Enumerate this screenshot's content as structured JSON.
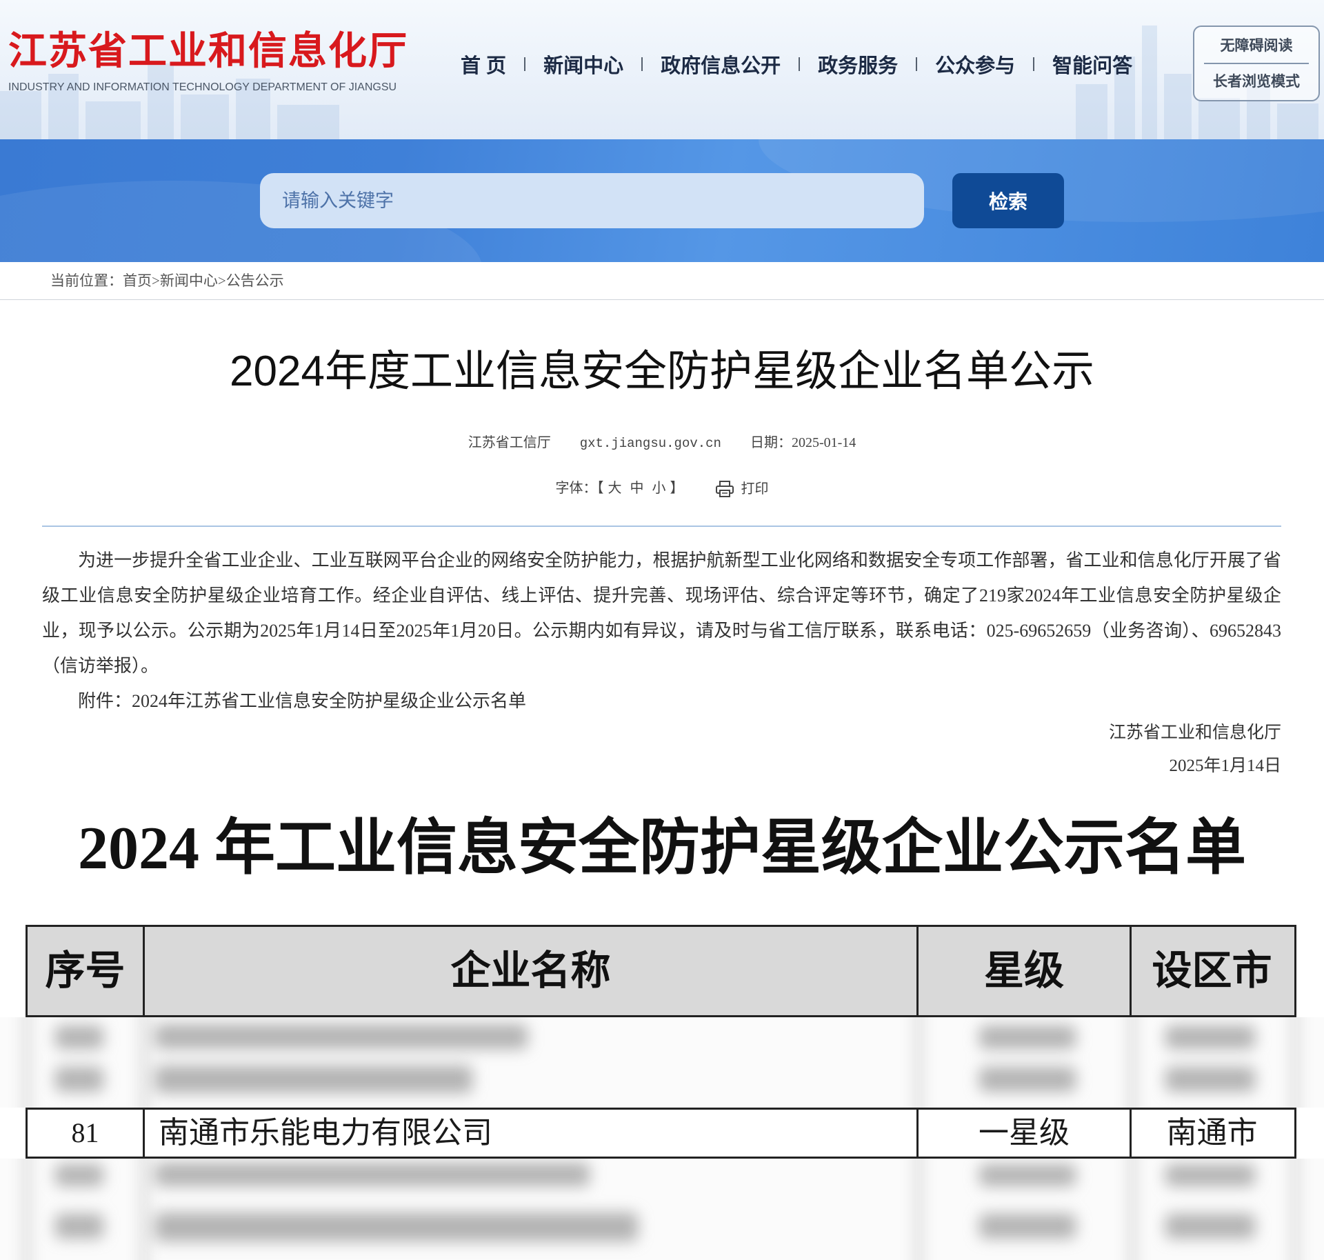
{
  "theme": {
    "brand_red": "#d8191d",
    "band_blue": "#3f80d8",
    "button_blue": "#0f4a96",
    "rule_blue": "#a9c4e3"
  },
  "header": {
    "logo_cn": "江苏省工业和信息化厅",
    "logo_en": "INDUSTRY AND INFORMATION TECHNOLOGY DEPARTMENT OF JIANGSU",
    "nav": [
      "首 页",
      "新闻中心",
      "政府信息公开",
      "政务服务",
      "公众参与",
      "智能问答"
    ],
    "accessibility": [
      "无障碍阅读",
      "长者浏览模式"
    ]
  },
  "search": {
    "placeholder": "请输入关键字",
    "button": "检索"
  },
  "breadcrumb": {
    "label": "当前位置：",
    "separator": ">",
    "items": [
      "首页",
      "新闻中心",
      "公告公示"
    ]
  },
  "article": {
    "title": "2024年度工业信息安全防护星级企业名单公示",
    "source": "江苏省工信厅",
    "site": "gxt.jiangsu.gov.cn",
    "date_label": "日期：",
    "date": "2025-01-14",
    "font_label": "字体：",
    "bracket_open": "【",
    "font_sizes": [
      "大",
      "中",
      "小"
    ],
    "bracket_close": "】",
    "print_icon": "printer-icon",
    "print": "打印",
    "body": "为进一步提升全省工业企业、工业互联网平台企业的网络安全防护能力，根据护航新型工业化网络和数据安全专项工作部署，省工业和信息化厅开展了省级工业信息安全防护星级企业培育工作。经企业自评估、线上评估、提升完善、现场评估、综合评定等环节，确定了219家2024年工业信息安全防护星级企业，现予以公示。公示期为2025年1月14日至2025年1月20日。公示期内如有异议，请及时与省工信厅联系，联系电话：025-69652659（业务咨询）、69652843（信访举报）。",
    "attachment_label": "附件：",
    "attachment": "2024年江苏省工业信息安全防护星级企业公示名单",
    "signature_org": "江苏省工业和信息化厅",
    "signature_date": "2025年1月14日"
  },
  "document": {
    "title": "2024 年工业信息安全防护星级企业公示名单",
    "headers": [
      "序号",
      "企业名称",
      "星级",
      "设区市"
    ],
    "rows": [
      {
        "no": "81",
        "name": "南通市乐能电力有限公司",
        "star": "一星级",
        "city": "南通市"
      }
    ]
  }
}
